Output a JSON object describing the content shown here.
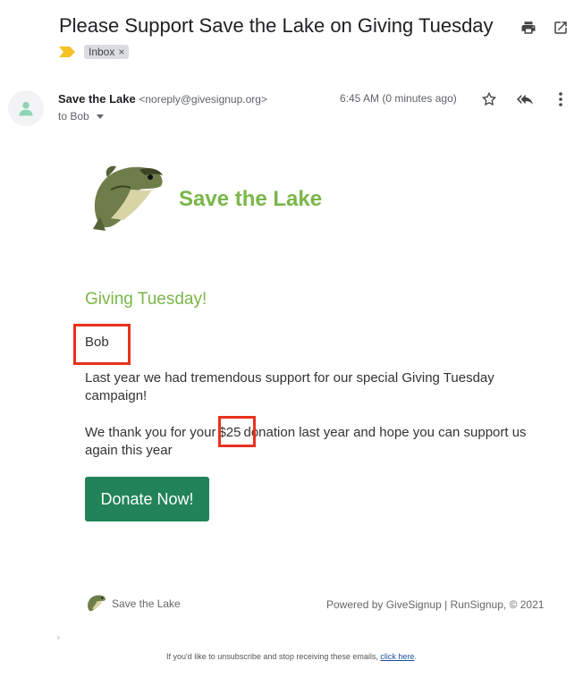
{
  "email": {
    "subject": "Please Support Save the Lake on Giving Tuesday",
    "label": "Inbox",
    "label_close": "×",
    "sender_name": "Save the Lake",
    "sender_email": "<noreply@givesignup.org>",
    "recipient": "to Bob",
    "timestamp": "6:45 AM (0 minutes ago)"
  },
  "icons": {
    "print": "print-icon",
    "open_new": "open-in-new-icon",
    "star": "star-icon",
    "reply_all": "reply-all-icon",
    "more": "more-vert-icon",
    "avatar": "person-icon",
    "important": "important-marker-icon"
  },
  "body": {
    "brand": "Save the Lake",
    "heading": "Giving Tuesday!",
    "greeting": "Bob",
    "paragraph1": "Last year we had tremendous support for our special Giving Tuesday campaign!",
    "paragraph2_before": "We thank you for your",
    "amount": "$25",
    "paragraph2_after": "donation last year and hope you can support us again this year",
    "donate_label": "Donate Now!"
  },
  "footer": {
    "brand": "Save the Lake",
    "powered_by": "Powered by GiveSignup | RunSignup, © 2021",
    "unsubscribe_text": "If you'd like to unsubscribe and stop receiving these emails,",
    "unsubscribe_link": "click here",
    "unsubscribe_end": "."
  },
  "colors": {
    "brand_green": "#7ab648",
    "button_green": "#218357",
    "highlight_red": "#e8321e",
    "link_blue": "#1a4f9c"
  }
}
